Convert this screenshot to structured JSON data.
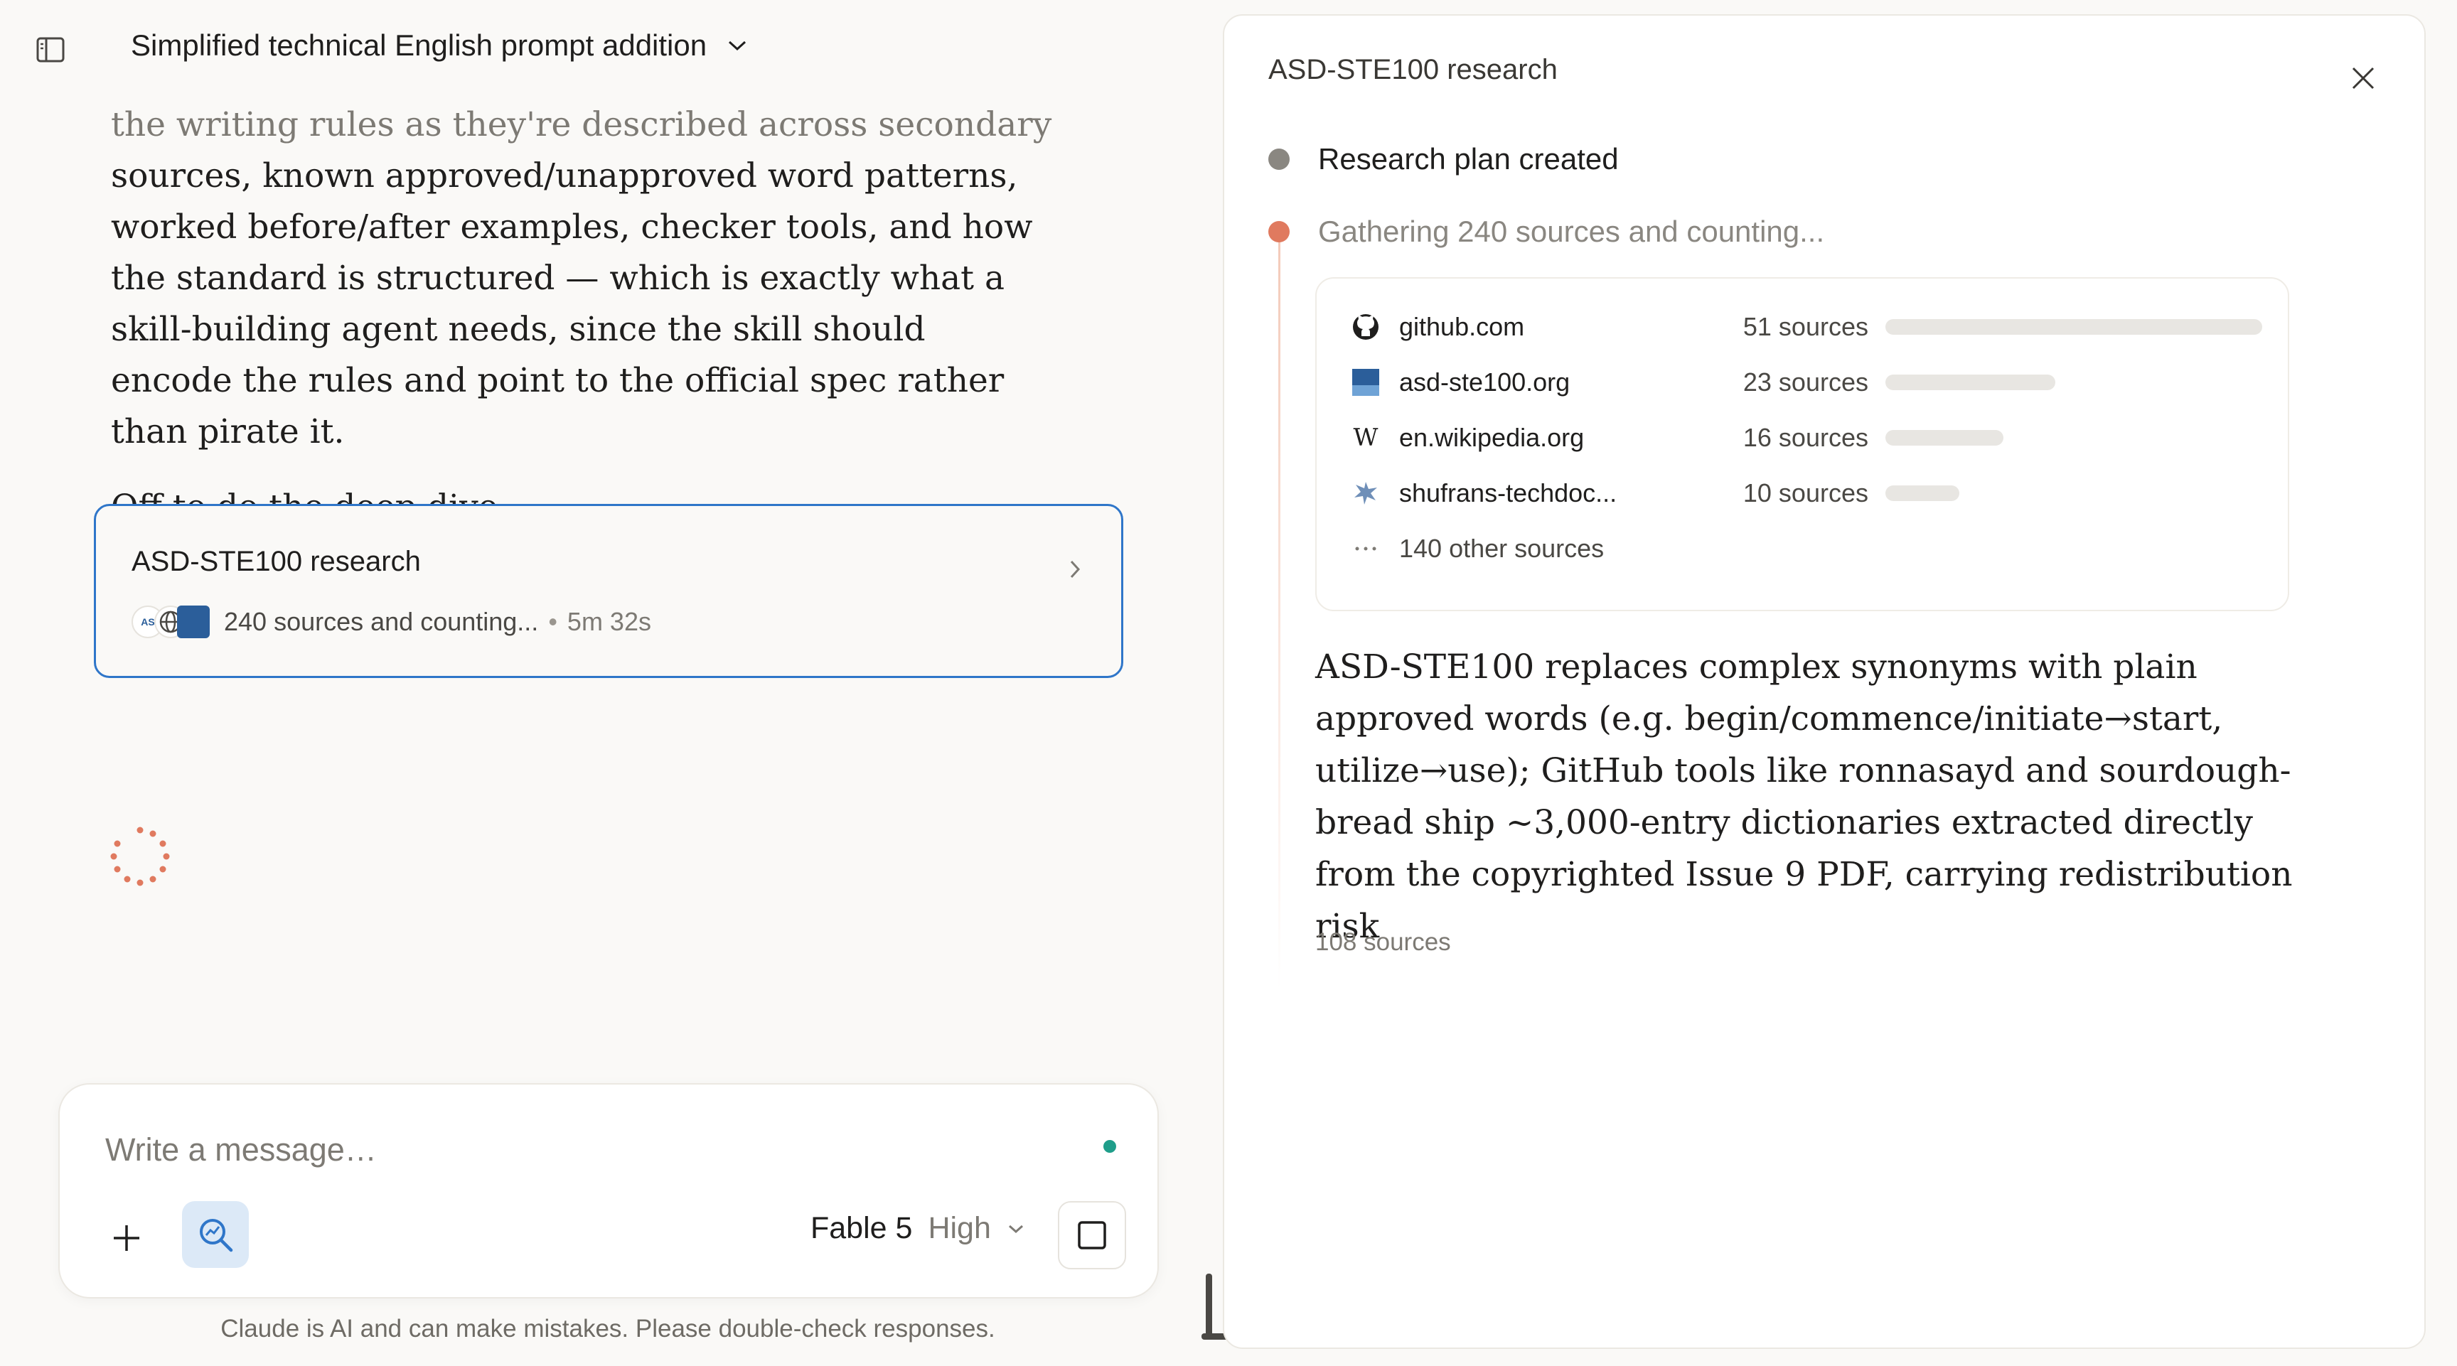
{
  "header": {
    "title": "Simplified technical English prompt addition"
  },
  "response": {
    "line1": "the writing rules as they're described across secondary",
    "line_rest": "sources, known approved/unapproved word patterns, worked before/after examples, checker tools, and how the standard is structured — which is exactly what a skill-building agent needs, since the skill should encode the rules and point to the official spec rather than pirate it.",
    "para2": "Off to do the deep dive."
  },
  "research_card": {
    "title": "ASD-STE100 research",
    "status": "240 sources and counting...",
    "separator": "•",
    "elapsed": "5m 32s",
    "favicon_label": "AS"
  },
  "composer": {
    "placeholder": "Write a message…",
    "model": "Fable 5",
    "effort": "High"
  },
  "disclaimer": "Claude is AI and can make mistakes. Please double-check responses.",
  "panel": {
    "title": "ASD-STE100 research",
    "steps": [
      {
        "label": "Research plan created",
        "state": "done"
      },
      {
        "label": "Gathering 240 sources and counting...",
        "state": "active"
      }
    ],
    "sources": [
      {
        "domain": "github.com",
        "count_label": "51 sources",
        "count": 51,
        "icon": "github-icon"
      },
      {
        "domain": "asd-ste100.org",
        "count_label": "23 sources",
        "count": 23,
        "icon": "asd-ste100-favicon"
      },
      {
        "domain": "en.wikipedia.org",
        "count_label": "16 sources",
        "count": 16,
        "icon": "wikipedia-icon",
        "glyph": "W"
      },
      {
        "domain": "shufrans-techdoc...",
        "count_label": "10 sources",
        "count": 10,
        "icon": "shufrans-favicon"
      }
    ],
    "other_sources": "140 other sources",
    "finding": "ASD-STE100 replaces complex synonyms with plain approved words (e.g. begin/commence/initiate→start, utilize→use); GitHub tools like ronnasayd and sourdough-bread ship ~3,000-entry dictionaries extracted directly from the copyrighted Issue 9 PDF, carrying redistribution risk",
    "finding_sources": "108 sources"
  },
  "colors": {
    "accent_blue": "#2f76c9",
    "active_orange": "#e07a5f",
    "status_teal": "#1f9e8a"
  }
}
